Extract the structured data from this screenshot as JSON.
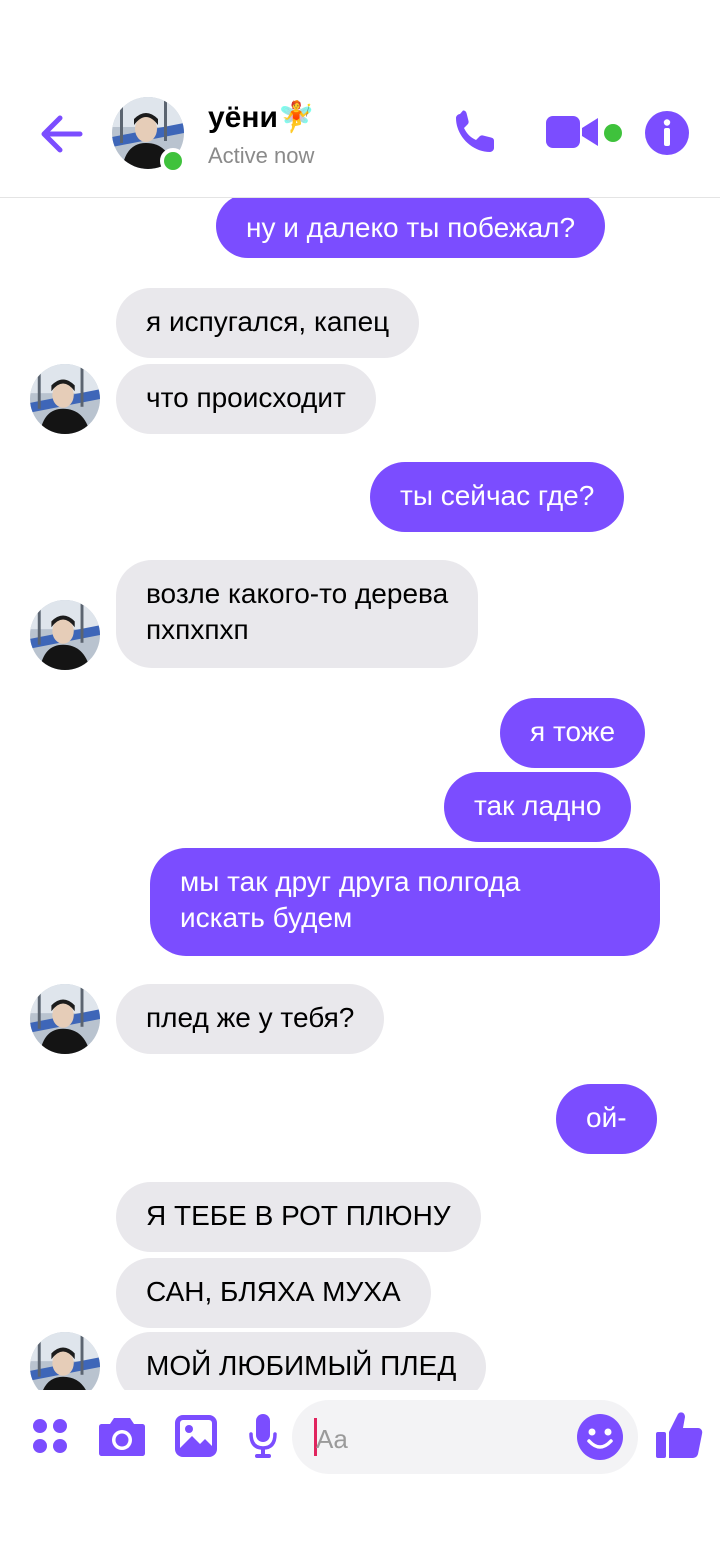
{
  "header": {
    "back_icon": "arrow-left-icon",
    "contact_name": "уёни🧚",
    "status": "Active now",
    "icons": [
      "phone-icon",
      "video-camera-icon",
      "info-icon"
    ],
    "accent_color": "#7b4dff",
    "online_color": "#3fc23c"
  },
  "messages": [
    {
      "from": "me",
      "text": "ну и далеко ты побежал?"
    },
    {
      "from": "them",
      "text": "я испугался, капец"
    },
    {
      "from": "them",
      "text": "что происходит"
    },
    {
      "from": "me",
      "text": "ты сейчас где?"
    },
    {
      "from": "them",
      "text": "возле какого-то дерева\nпхпхпхп"
    },
    {
      "from": "me",
      "text": "я тоже"
    },
    {
      "from": "me",
      "text": "так ладно"
    },
    {
      "from": "me",
      "text": "мы так друг друга полгода\nискать будем"
    },
    {
      "from": "them",
      "text": "плед же у тебя?"
    },
    {
      "from": "me",
      "text": "ой-"
    },
    {
      "from": "them",
      "text": "Я ТЕБЕ В РОТ ПЛЮНУ"
    },
    {
      "from": "them",
      "text": "САН, БЛЯХА МУХА"
    },
    {
      "from": "them",
      "text": "МОЙ ЛЮБИМЫЙ ПЛЕД"
    }
  ],
  "composer": {
    "placeholder": "Aa",
    "icons": [
      "apps-grid-icon",
      "camera-icon",
      "gallery-icon",
      "microphone-icon",
      "emoji-icon",
      "thumbs-up-icon"
    ]
  }
}
